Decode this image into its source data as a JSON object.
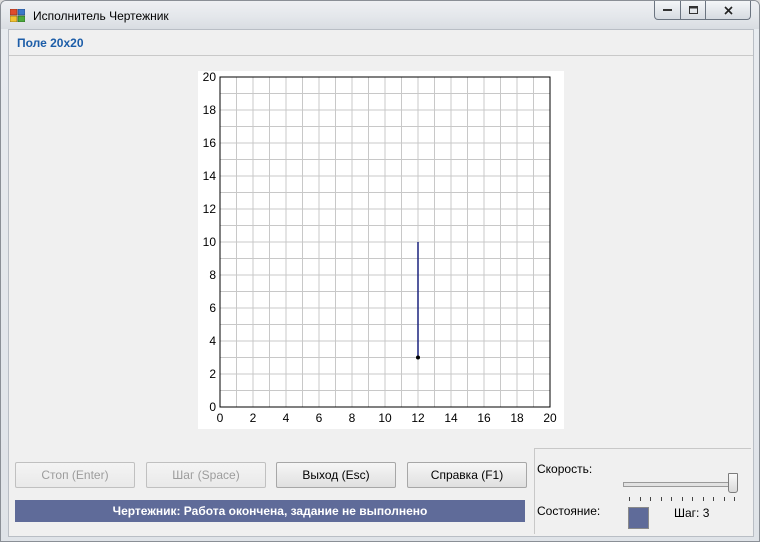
{
  "window": {
    "title": "Исполнитель Чертежник"
  },
  "field": {
    "title": "Поле 20x20"
  },
  "chart_data": {
    "type": "line",
    "xlim": [
      0,
      20
    ],
    "ylim": [
      0,
      20
    ],
    "xticks": [
      "0",
      "2",
      "4",
      "6",
      "8",
      "10",
      "12",
      "14",
      "16",
      "18",
      "20"
    ],
    "yticks": [
      "0",
      "2",
      "4",
      "6",
      "8",
      "10",
      "12",
      "14",
      "16",
      "18",
      "20"
    ],
    "grid": true,
    "series": [
      {
        "x": [
          12,
          12
        ],
        "y": [
          10,
          3
        ]
      }
    ],
    "pen_position": {
      "x": 12,
      "y": 3
    },
    "line_color": "#1a237e"
  },
  "buttons": {
    "stop": "Стоп (Enter)",
    "step": "Шаг (Space)",
    "exit": "Выход (Esc)",
    "help": "Справка (F1)"
  },
  "status": {
    "message": "Чертежник: Работа окончена, задание не выполнено"
  },
  "speed": {
    "label": "Скорость:",
    "value": 1.0
  },
  "state": {
    "label": "Состояние:",
    "step_text": "Шаг: 3",
    "color": "#5f6b99"
  }
}
